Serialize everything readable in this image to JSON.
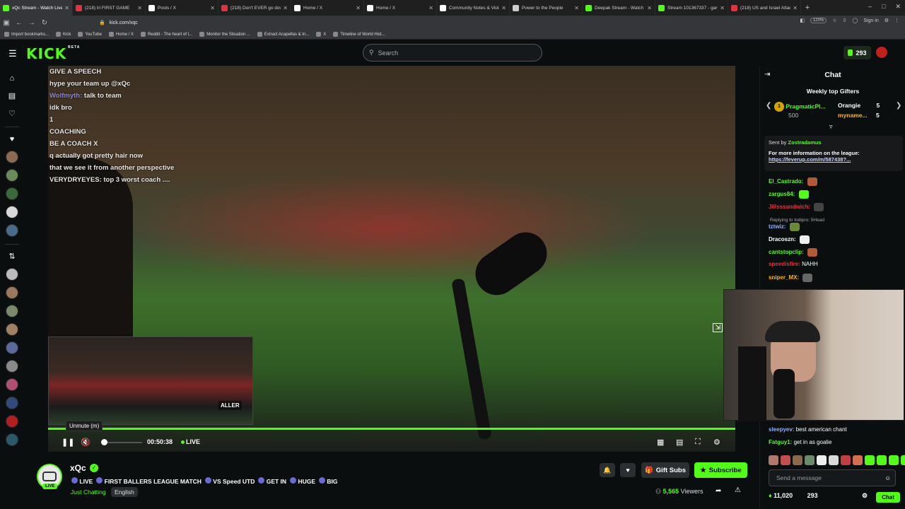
{
  "browser": {
    "tabs": [
      {
        "label": "xQc Stream - Watch Live",
        "color": "#53fc18",
        "active": true
      },
      {
        "label": "(218) lrl FIRST GAME",
        "color": "#e5303d",
        "active": false
      },
      {
        "label": "Posts / X",
        "color": "#ffffff",
        "active": false
      },
      {
        "label": "(218) Don't EVER go down",
        "color": "#e5303d",
        "active": false
      },
      {
        "label": "Home / X",
        "color": "#ffffff",
        "active": false
      },
      {
        "label": "Home / X",
        "color": "#ffffff",
        "active": false
      },
      {
        "label": "Community Notes & Violati",
        "color": "#ffffff",
        "active": false
      },
      {
        "label": "Power to the People",
        "color": "#cccccc",
        "active": false
      },
      {
        "label": "Deepak Stream - Watch Liv",
        "color": "#53fc18",
        "active": false
      },
      {
        "label": "Stream 101367337 - garyda",
        "color": "#53fc18",
        "active": false
      },
      {
        "label": "(218) US and Israel Attack",
        "color": "#e5303d",
        "active": false
      }
    ],
    "url": "kick.com/xqc",
    "zoom": "120%",
    "signin": "Sign in",
    "bookmarks": [
      "Import bookmarks...",
      "Kick",
      "YouTube",
      "Home / X",
      "Reddit - The heart of t...",
      "Monitor the Situation ...",
      "Extract Acapellas & In...",
      "X",
      "Timeline of World Hist..."
    ]
  },
  "topnav": {
    "logo": "KICK",
    "logo_badge": "BETA",
    "search_placeholder": "Search",
    "points": "293"
  },
  "player": {
    "overlay_chat": [
      {
        "user": "",
        "text": "GIVE A SPEECH"
      },
      {
        "user": "",
        "text": "hype your team up @xQc"
      },
      {
        "user": "Wolfmyth:",
        "text": "talk to team"
      },
      {
        "user": "",
        "text": "idk bro"
      },
      {
        "user": "",
        "text": "1"
      },
      {
        "user": "",
        "text": "COACHING"
      },
      {
        "user": "",
        "text": "BE A COACH X"
      },
      {
        "user": "",
        "text": "q actually got pretty hair now"
      },
      {
        "user": "",
        "text": "that we see it from another perspective"
      },
      {
        "user": "",
        "text": "VERYDRYEYES: top 3 worst coach ...."
      }
    ],
    "tooltip": "Unmute (m)",
    "time": "00:50:38",
    "live": "LIVE",
    "progress": 1.0
  },
  "channel": {
    "name": "xQc",
    "live_badge": "LIVE",
    "title_parts": [
      "LIVE",
      "FIRST BALLERS LEAGUE MATCH",
      "VS Speed UTD",
      "GET IN",
      "HUGE",
      "BIG"
    ],
    "category": "Just Chatting",
    "language": "English",
    "gift_label": "Gift Subs",
    "subscribe_label": "Subscribe",
    "viewers_count": "5,565",
    "viewers_label": "Viewers"
  },
  "chat": {
    "title": "Chat",
    "gifters_title": "Weekly top Gifters",
    "gifters": [
      {
        "name": "PragmaticPl...",
        "count": "500"
      },
      {
        "name": "Orangie",
        "count": "5"
      },
      {
        "name": "myname...",
        "count": "5"
      }
    ],
    "pinned": {
      "sent_by_label": "Sent by",
      "sent_by_user": "Zostradamus",
      "text": "For more information on the league:",
      "link": "https://feverup.com/m/587438?..."
    },
    "messages": [
      {
        "user": "El_Castrado:",
        "color": "#53fc18",
        "text": ""
      },
      {
        "user": "zargus84:",
        "color": "#53fc18",
        "text": ""
      },
      {
        "user": "Jillsssandwich:",
        "color": "#e5303d",
        "text": ""
      },
      {
        "user": "tztwiz:",
        "color": "#8fb0ff",
        "text": ""
      },
      {
        "user": "Dracoszn:",
        "color": "#ffffff",
        "text": ""
      },
      {
        "user": "cantstopclip:",
        "color": "#53fc18",
        "text": ""
      },
      {
        "user": "speedisfire:",
        "color": "#e5303d",
        "text": "NAHH"
      },
      {
        "user": "sniper_MX:",
        "color": "#ffb400",
        "text": ""
      }
    ],
    "reply_to": "Replying to todipro: 5Head",
    "bottom_messages": [
      {
        "user": "sleepyev:",
        "color": "#8fb0ff",
        "text": "best american chant"
      },
      {
        "user": "Fatguy1:",
        "color": "#53fc18",
        "text": "get in as goalie"
      }
    ],
    "input_placeholder": "Send a message",
    "footer_count1": "11,020",
    "footer_count2": "293",
    "send_label": "Chat"
  }
}
